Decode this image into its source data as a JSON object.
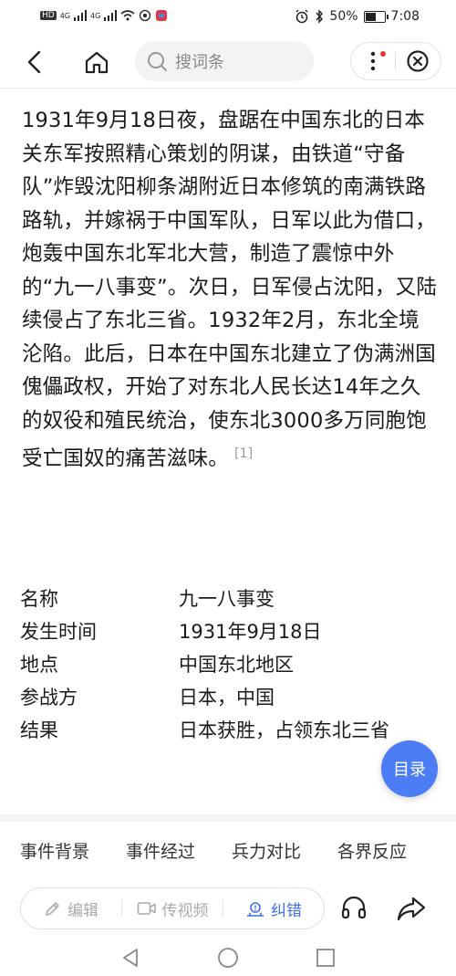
{
  "status_bar": {
    "hd_label": "HD",
    "signal_label_1": "4G",
    "signal_label_2": "4G",
    "battery_percent": "50%",
    "battery_level": 0.5,
    "time": "7:08"
  },
  "nav": {
    "search_placeholder": "搜词条",
    "icons": [
      "back-arrow",
      "home",
      "search",
      "more-vertical",
      "close-circle"
    ]
  },
  "article": {
    "text": "1931年9月18日夜，盘踞在中国东北的日本关东军按照精心策划的阴谋，由铁道“守备队”炸毁沈阳柳条湖附近日本修筑的南满铁路路轨，并嫁祸于中国军队，日军以此为借口，炮轰中国东北军北大营，制造了震惊中外的“九一八事变”。次日，日军侵占沈阳，又陆续侵占了东北三省。1932年2月，东北全境沦陷。此后，日本在中国东北建立了伪满洲国傀儡政权，开始了对东北人民长达14年之久的奴役和殖民统治，使东北3000多万同胞饱受亡国奴的痛苦滋味。",
    "citation": "[1]"
  },
  "info": [
    {
      "key": "名称",
      "value": "九一八事变"
    },
    {
      "key": "发生时间",
      "value": "1931年9月18日"
    },
    {
      "key": "地点",
      "value": "中国东北地区"
    },
    {
      "key": "参战方",
      "value": "日本，中国"
    },
    {
      "key": "结果",
      "value": "日本获胜，占领东北三省"
    }
  ],
  "toc_button": "目录",
  "section_tabs": [
    "事件背景",
    "事件经过",
    "兵力对比",
    "各界反应"
  ],
  "toolbar": {
    "edit_label": "编辑",
    "video_label": "传视频",
    "correct_label": "纠错"
  },
  "colors": {
    "accent": "#3f6fe8",
    "fab": "#4d7cf7",
    "notify_dot": "#e8343c"
  }
}
